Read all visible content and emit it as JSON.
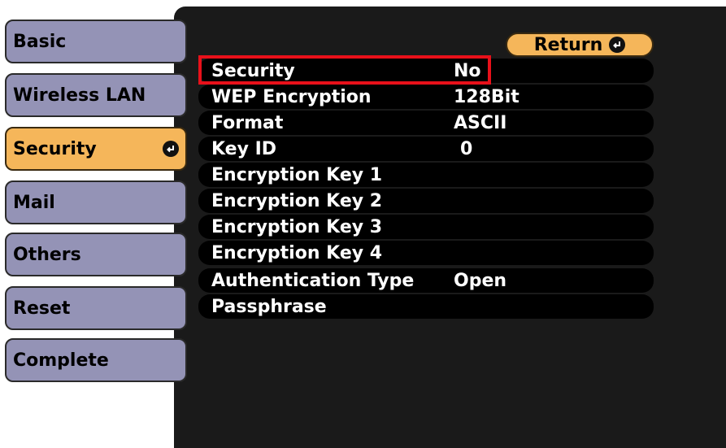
{
  "sidebar": {
    "items": [
      {
        "label": "Basic"
      },
      {
        "label": "Wireless LAN"
      },
      {
        "label": "Security",
        "active": true
      },
      {
        "label": "Mail"
      },
      {
        "label": "Others"
      },
      {
        "label": "Reset"
      },
      {
        "label": "Complete"
      }
    ]
  },
  "header": {
    "return_label": "Return"
  },
  "settings": {
    "rows": [
      {
        "label": "Security",
        "value": "No"
      },
      {
        "label": "WEP Encryption",
        "value": "128Bit"
      },
      {
        "label": "Format",
        "value": "ASCII"
      },
      {
        "label": "Key ID",
        "value": "0"
      },
      {
        "label": "Encryption Key 1",
        "value": ""
      },
      {
        "label": "Encryption Key 2",
        "value": ""
      },
      {
        "label": "Encryption Key 3",
        "value": ""
      },
      {
        "label": "Encryption Key 4",
        "value": ""
      },
      {
        "label": "Authentication Type",
        "value": "Open"
      },
      {
        "label": "Passphrase",
        "value": ""
      }
    ]
  },
  "colors": {
    "panel_bg": "#1a1a1a",
    "sidebar_item": "#9493b6",
    "active_item": "#f5b65a",
    "highlight_border": "#e8101a"
  },
  "icons": {
    "enter": "enter-icon"
  }
}
